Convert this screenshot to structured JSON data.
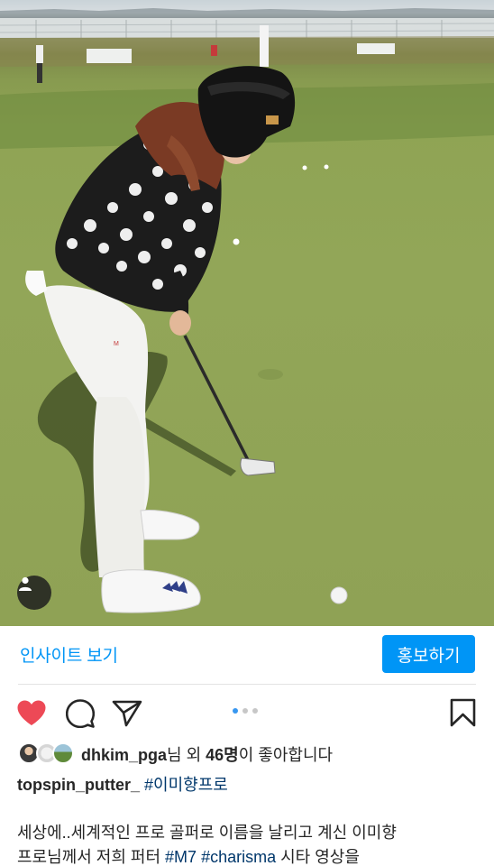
{
  "post": {
    "photo_alt": "golfer-putting-on-green"
  },
  "actions": {
    "insights_label": "인사이트 보기",
    "promote_label": "홍보하기"
  },
  "icons": {
    "like": "heart-filled-icon",
    "comment": "comment-icon",
    "share": "send-icon",
    "save": "bookmark-icon",
    "user_tags": "user-tag-icon"
  },
  "carousel": {
    "count": 3,
    "active_index": 0
  },
  "likes": {
    "username": "dhkim_pga",
    "middle": "님 외 ",
    "count": "46명",
    "suffix": "이 좋아합니다"
  },
  "caption": {
    "username": "topspin_putter_",
    "hashtag": "#이미향프로",
    "line1": "세상에..세계적인 프로 골퍼로 이름을 날리고 계신 이미향",
    "line2_prefix": "프로님께서 저희 퍼터 ",
    "line2_tag1": "#M7",
    "line2_tag2": "#charisma",
    "line2_suffix": " 시타 영상을"
  },
  "colors": {
    "accent": "#0095f6",
    "like_red": "#ed4956",
    "hashtag": "#00376b",
    "text": "#262626"
  }
}
